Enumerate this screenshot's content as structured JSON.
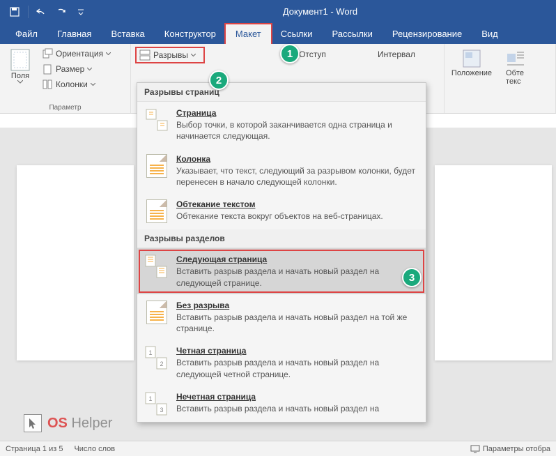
{
  "title": "Документ1  -  Word",
  "tabs": [
    "Файл",
    "Главная",
    "Вставка",
    "Конструктор",
    "Макет",
    "Ссылки",
    "Рассылки",
    "Рецензирование",
    "Вид"
  ],
  "active_tab": 4,
  "ribbon": {
    "margins": "Поля",
    "orientation": "Ориентация",
    "size": "Размер",
    "columns": "Колонки",
    "breaks": "Разрывы",
    "group_page_setup": "Параметр",
    "indent": "Отступ",
    "spacing": "Интервал",
    "position": "Положение",
    "wrap": "Обте\nтекс"
  },
  "gallery": {
    "section1": "Разрывы страниц",
    "section2": "Разрывы разделов",
    "items1": [
      {
        "title": "Страница",
        "desc": "Выбор точки, в которой заканчивается одна страница и начинается следующая."
      },
      {
        "title": "Колонка",
        "desc": "Указывает, что текст, следующий за разрывом колонки, будет перенесен в начало следующей колонки."
      },
      {
        "title": "Обтекание текстом",
        "desc": "Обтекание текста вокруг объектов на веб-страницах."
      }
    ],
    "items2": [
      {
        "title": "Следующая страница",
        "desc": "Вставить разрыв раздела и начать новый раздел на следующей странице."
      },
      {
        "title": "Без разрыва",
        "desc": "Вставить разрыв раздела и начать новый раздел на той же странице."
      },
      {
        "title": "Четная страница",
        "desc": "Вставить разрыв раздела и начать новый раздел на следующей четной странице."
      },
      {
        "title": "Нечетная страница",
        "desc": "Вставить разрыв раздела и начать новый раздел на"
      }
    ]
  },
  "status": {
    "page": "Страница 1 из 5",
    "words": "Число слов",
    "display": "Параметры отобра"
  },
  "markers": [
    "1",
    "2",
    "3"
  ],
  "watermark": {
    "os": "OS",
    "helper": "Helper"
  }
}
